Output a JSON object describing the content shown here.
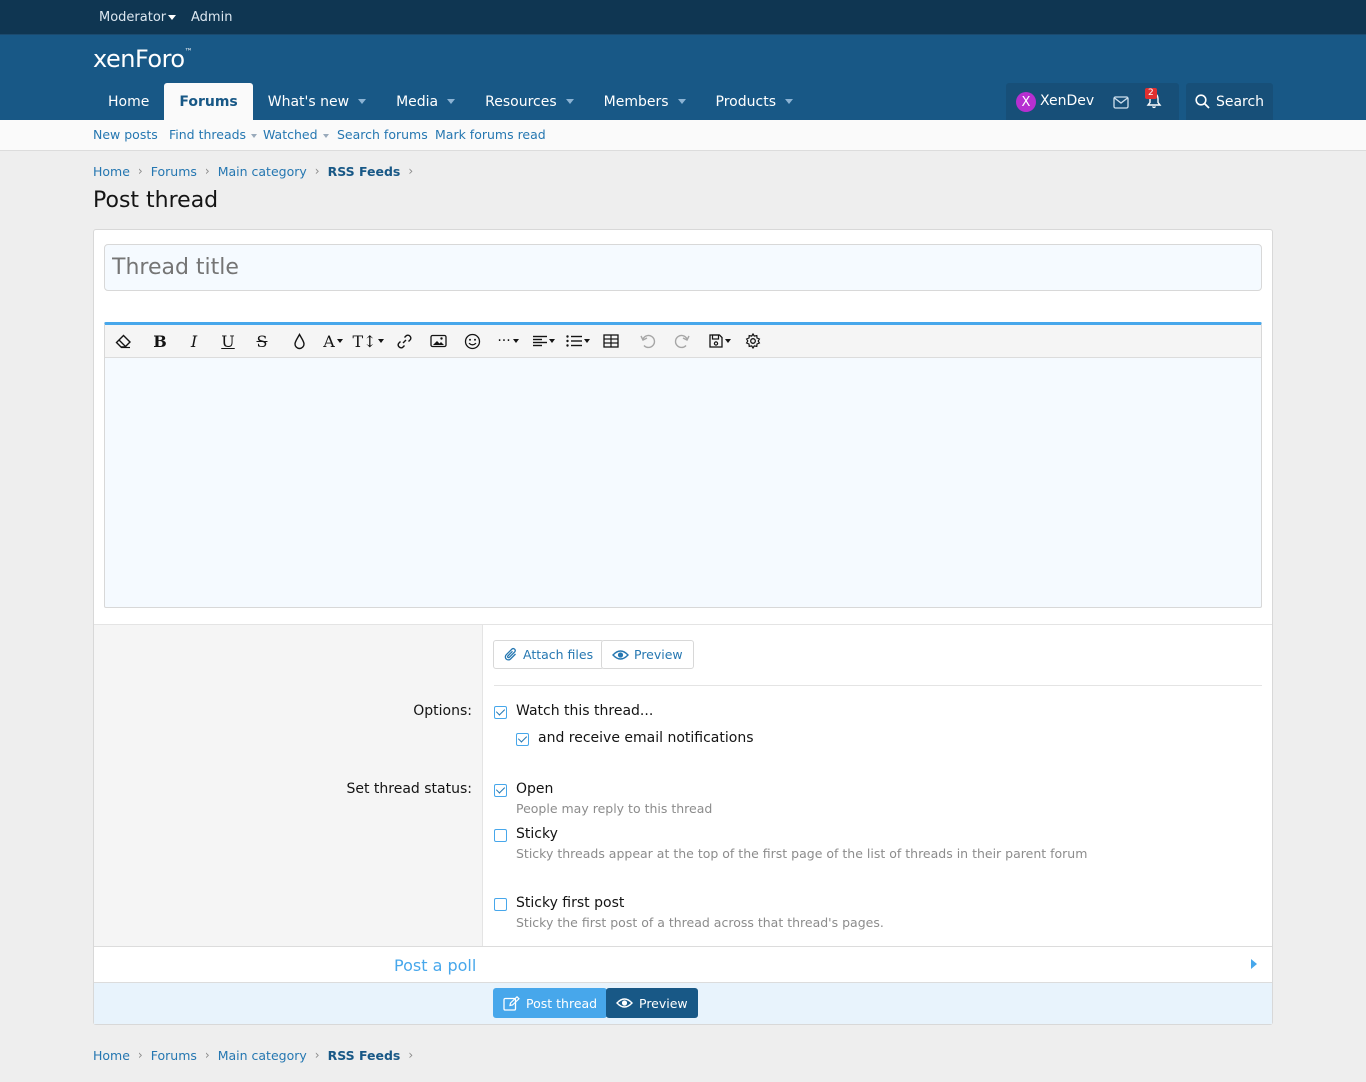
{
  "topbar": {
    "moderator": "Moderator",
    "admin": "Admin"
  },
  "header": {
    "logo": "xenForo",
    "logo_mark": "™",
    "tabs": [
      "Home",
      "Forums",
      "What's new",
      "Media",
      "Resources",
      "Members",
      "Products"
    ],
    "user": {
      "avatar_letter": "X",
      "name": "XenDev",
      "alert_count": "2"
    },
    "search": "Search"
  },
  "subnav": [
    "New posts",
    "Find threads",
    "Watched",
    "Search forums",
    "Mark forums read"
  ],
  "breadcrumb": [
    "Home",
    "Forums",
    "Main category",
    "RSS Feeds"
  ],
  "page_title": "Post thread",
  "form": {
    "title_placeholder": "Thread title",
    "attach_label": "Attach files",
    "preview_label": "Preview",
    "options_label": "Options:",
    "watch_label": "Watch this thread...",
    "email_label": "and receive email notifications",
    "status_label": "Set thread status:",
    "open_label": "Open",
    "open_hint": "People may reply to this thread",
    "sticky_label": "Sticky",
    "sticky_hint": "Sticky threads appear at the top of the first page of the list of threads in their parent forum",
    "sticky_first_label": "Sticky first post",
    "sticky_first_hint": "Sticky the first post of a thread across that thread's pages.",
    "poll_label": "Post a poll",
    "submit_label": "Post thread",
    "preview_submit_label": "Preview"
  },
  "colors": {
    "header": "#185886",
    "topbar": "#0f3652",
    "accent": "#47a7eb",
    "link": "#2577b1",
    "avatar": "#b62fd1"
  }
}
